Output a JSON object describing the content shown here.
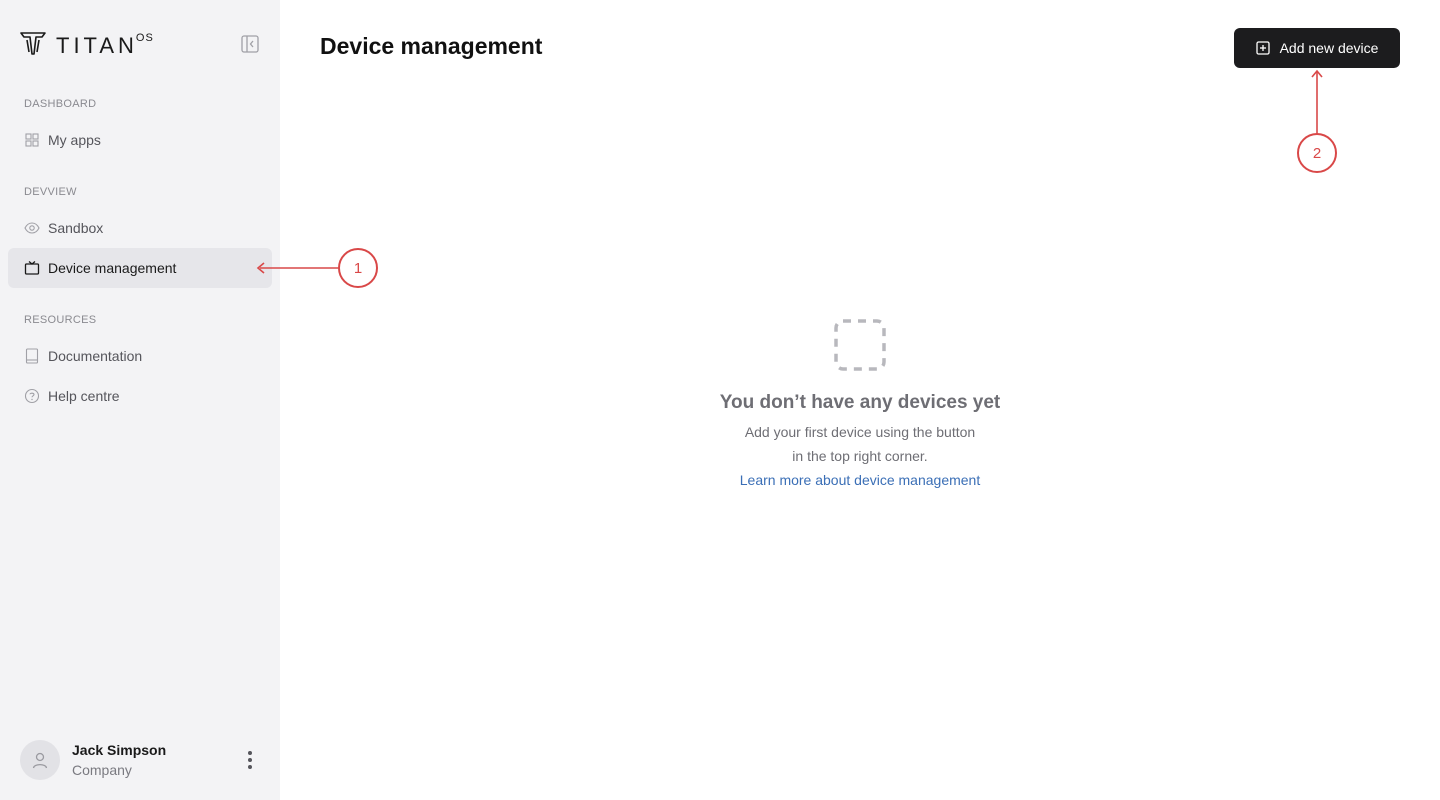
{
  "brand": {
    "name": "TITAN",
    "suffix": "OS"
  },
  "sidebar": {
    "sections": [
      {
        "label": "DASHBOARD",
        "items": [
          {
            "label": "My apps",
            "icon": "grid-icon"
          }
        ]
      },
      {
        "label": "DEVVIEW",
        "items": [
          {
            "label": "Sandbox",
            "icon": "eye-icon"
          },
          {
            "label": "Device management",
            "icon": "tv-icon",
            "active": true
          }
        ]
      },
      {
        "label": "RESOURCES",
        "items": [
          {
            "label": "Documentation",
            "icon": "book-icon"
          },
          {
            "label": "Help centre",
            "icon": "help-circle-icon"
          }
        ]
      }
    ],
    "user": {
      "name": "Jack Simpson",
      "company": "Company"
    }
  },
  "header": {
    "title": "Device management",
    "add_button_label": "Add new device"
  },
  "empty_state": {
    "heading": "You don’t have any devices yet",
    "line1": "Add your first device using the button",
    "line2": "in the top right corner.",
    "link": "Learn more about device management"
  },
  "annotations": {
    "marker_1": "1",
    "marker_2": "2"
  },
  "colors": {
    "accent_dark": "#1c1c1e",
    "annotation": "#d94848",
    "link": "#3b6fb6",
    "sidebar_bg": "#f3f3f5"
  }
}
